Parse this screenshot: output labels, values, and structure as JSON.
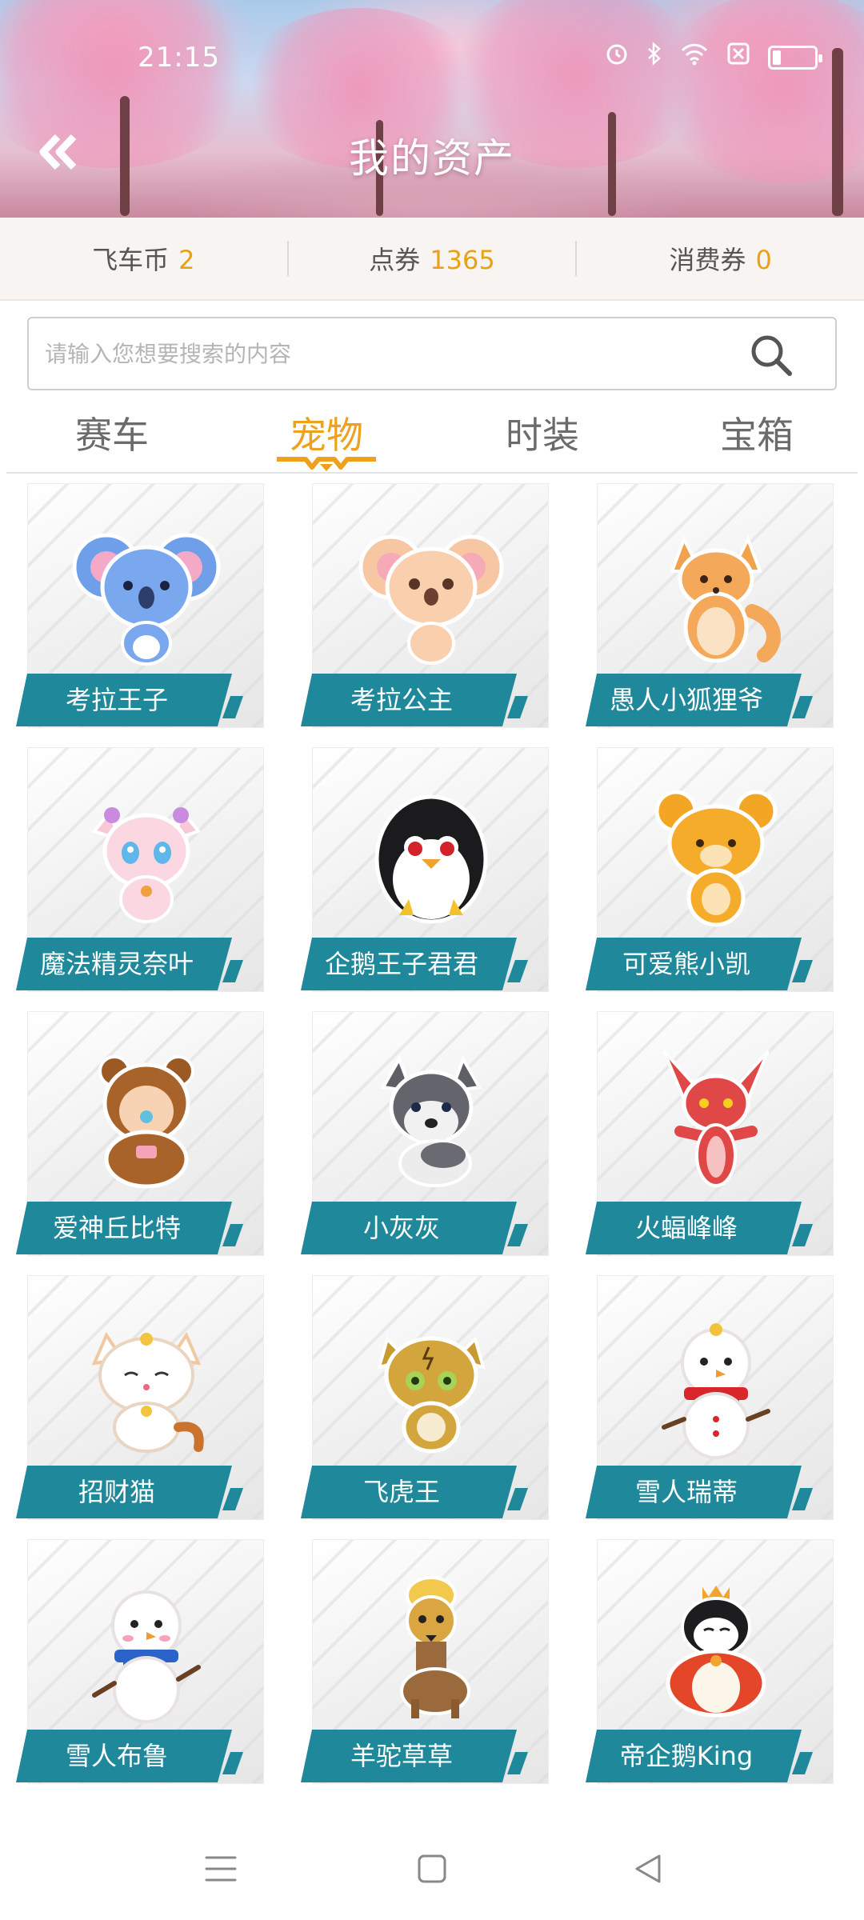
{
  "status_bar": {
    "time": "21:15"
  },
  "header": {
    "title": "我的资产"
  },
  "currencies": [
    {
      "label": "飞车币",
      "value": "2"
    },
    {
      "label": "点券",
      "value": "1365"
    },
    {
      "label": "消费券",
      "value": "0"
    }
  ],
  "search": {
    "placeholder": "请输入您想要搜索的内容"
  },
  "tabs": [
    {
      "label": "赛车",
      "active": false
    },
    {
      "label": "宠物",
      "active": true
    },
    {
      "label": "时装",
      "active": false
    },
    {
      "label": "宝箱",
      "active": false
    }
  ],
  "pets": [
    {
      "name": "考拉王子",
      "icon": "blue-koala"
    },
    {
      "name": "考拉公主",
      "icon": "pink-koala"
    },
    {
      "name": "愚人小狐狸爷",
      "icon": "fox"
    },
    {
      "name": "魔法精灵奈叶",
      "icon": "pink-cat"
    },
    {
      "name": "企鹅王子君君",
      "icon": "penguin"
    },
    {
      "name": "可爱熊小凯",
      "icon": "bear"
    },
    {
      "name": "爱神丘比特",
      "icon": "bear-suit-baby"
    },
    {
      "name": "小灰灰",
      "icon": "husky"
    },
    {
      "name": "火蝠峰峰",
      "icon": "red-bat"
    },
    {
      "name": "招财猫",
      "icon": "lucky-cat"
    },
    {
      "name": "飞虎王",
      "icon": "tiger"
    },
    {
      "name": "雪人瑞蒂",
      "icon": "snowman-red-scarf"
    },
    {
      "name": "雪人布鲁",
      "icon": "snowman-blue-scarf"
    },
    {
      "name": "羊驼草草",
      "icon": "alpaca"
    },
    {
      "name": "帝企鹅King",
      "icon": "emperor-penguin"
    }
  ],
  "colors": {
    "accent": "#eea11c",
    "currency_value": "#e9a116",
    "label_bar": "#1f889a",
    "tab_inactive": "#6b6b6b"
  }
}
